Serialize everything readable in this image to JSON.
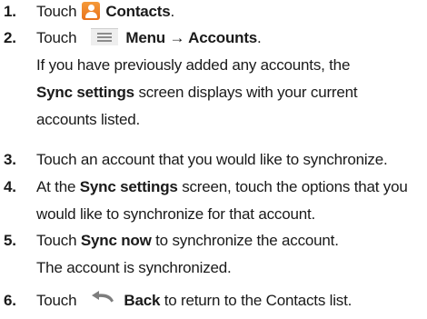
{
  "icons": {
    "contacts": "contacts-icon",
    "menu": "menu-icon",
    "back": "back-arrow-icon",
    "contacts_color": "#f08a2a"
  },
  "steps": [
    {
      "number": "1.",
      "pre": "Touch",
      "bold": "Contacts",
      "post": "."
    },
    {
      "number": "2.",
      "pre": "Touch",
      "bold": "Menu → Accounts",
      "post": ".",
      "note": {
        "line1": "If you have previously added any accounts, the",
        "bold": "Sync settings",
        "line2_rest": " screen displays with your current",
        "line3": "accounts listed."
      }
    },
    {
      "number": "3.",
      "text": "Touch an account that you would like to synchronize."
    },
    {
      "number": "4.",
      "pre": "At the ",
      "bold": "Sync settings",
      "post": " screen, touch the options that you",
      "line2": "would like to synchronize for that account."
    },
    {
      "number": "5.",
      "pre": "Touch ",
      "bold": "Sync now",
      "post": " to synchronize the account.",
      "line2": "The account is synchronized."
    },
    {
      "number": "6.",
      "pre": "Touch",
      "bold": "Back",
      "post": " to return to the Contacts list."
    }
  ]
}
